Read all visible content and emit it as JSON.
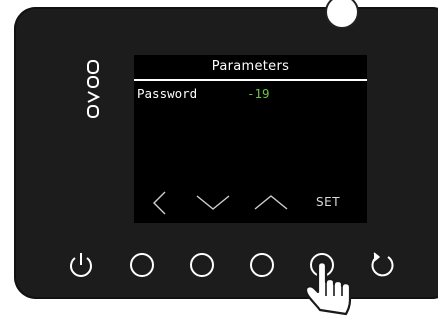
{
  "screen": {
    "title": "Parameters",
    "param_label": "Password",
    "param_value": "-19",
    "value_color": "#6cc04a"
  },
  "softkeys": {
    "left_icon": "chevron-left-icon",
    "down_icon": "chevron-down-icon",
    "up_icon": "chevron-up-icon",
    "set_label": "SET"
  },
  "hardware_buttons": [
    {
      "icon": "power-icon"
    },
    {
      "icon": "circle-button-icon"
    },
    {
      "icon": "circle-button-icon"
    },
    {
      "icon": "circle-button-icon"
    },
    {
      "icon": "circle-button-icon"
    },
    {
      "icon": "refresh-icon"
    }
  ],
  "pointer": {
    "icon": "hand-pointer-icon"
  },
  "colors": {
    "panel": "#1c1c1c",
    "display_bg": "#000000",
    "text": "#ffffff"
  }
}
